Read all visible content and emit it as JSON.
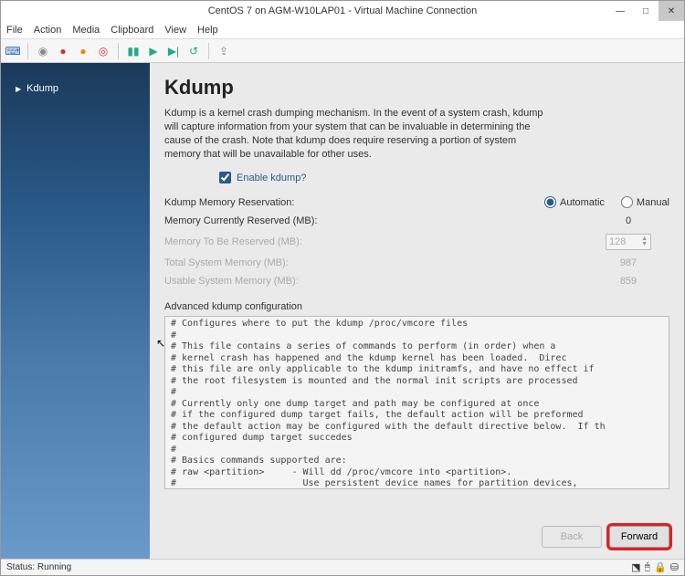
{
  "window": {
    "title": "CentOS 7 on AGM-W10LAP01 - Virtual Machine Connection",
    "min": "—",
    "max": "□",
    "close": "✕"
  },
  "menu": {
    "file": "File",
    "action": "Action",
    "media": "Media",
    "clipboard": "Clipboard",
    "view": "View",
    "help": "Help"
  },
  "sidebar": {
    "item0": "Kdump"
  },
  "main": {
    "heading": "Kdump",
    "desc": "Kdump is a kernel crash dumping mechanism. In the event of a system crash, kdump will capture information from your system that can be invaluable in determining the cause of the crash. Note that kdump does require reserving a portion of system memory that will be unavailable for other uses.",
    "enable_label": "Enable kdump?",
    "mem_reservation_label": "Kdump Memory Reservation:",
    "radio_auto": "Automatic",
    "radio_manual": "Manual",
    "mem_current_label": "Memory Currently Reserved (MB):",
    "mem_current_val": "0",
    "mem_tobereserved_label": "Memory To Be Reserved (MB):",
    "mem_tobereserved_val": "128",
    "total_label": "Total System Memory (MB):",
    "total_val": "987",
    "usable_label": "Usable System Memory (MB):",
    "usable_val": "859",
    "adv_label": "Advanced kdump configuration",
    "config_text": "# Configures where to put the kdump /proc/vmcore files\n#\n# This file contains a series of commands to perform (in order) when a\n# kernel crash has happened and the kdump kernel has been loaded.  Direc\n# this file are only applicable to the kdump initramfs, and have no effect if\n# the root filesystem is mounted and the normal init scripts are processed\n#\n# Currently only one dump target and path may be configured at once\n# if the configured dump target fails, the default action will be preformed\n# the default action may be configured with the default directive below.  If th\n# configured dump target succedes\n#\n# Basics commands supported are:\n# raw <partition>     - Will dd /proc/vmcore into <partition>.\n#                       Use persistent device names for partition devices,\n#                       such as /dev/vg/<devname>.\n#\n# nfs <nfs mount>       - Will mount fs and copy /proc/vmcore to\n#                       <mnt>/var/crash/%HOST-%DATE/, supports DNS.",
    "back": "Back",
    "forward": "Forward"
  },
  "status": {
    "text": "Status: Running"
  }
}
